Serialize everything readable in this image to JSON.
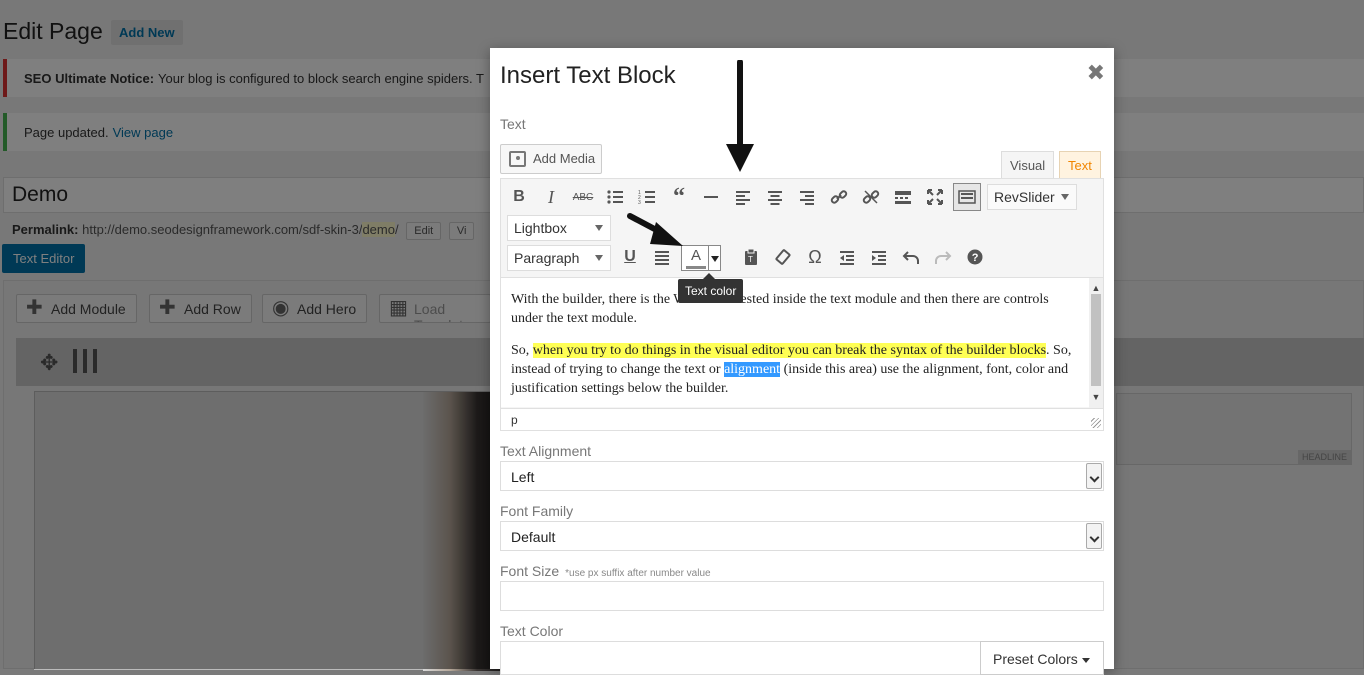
{
  "background": {
    "page_title": "Edit Page",
    "add_new": "Add New",
    "seo_notice": {
      "bold": "SEO Ultimate Notice:",
      "text": "Your blog is configured to block search engine spiders. T"
    },
    "updated_notice": {
      "text": "Page updated.",
      "link": "View page"
    },
    "post_title": "Demo",
    "permalink": {
      "label": "Permalink:",
      "url": "http://demo.seodesignframework.com/sdf-skin-3/",
      "slug": "demo",
      "trailing": "/",
      "edit": "Edit",
      "view": "Vi"
    },
    "text_editor_btn": "Text Editor",
    "builder_buttons": [
      "Add Module",
      "Add Row",
      "Add Hero",
      "Load Templat"
    ],
    "headline_tag": "HEADLINE"
  },
  "modal": {
    "title": "Insert Text Block",
    "text_label": "Text",
    "add_media": "Add Media",
    "tabs": {
      "visual": "Visual",
      "text": "Text"
    },
    "toolbar": {
      "revslider": "RevSlider",
      "lightbox": "Lightbox",
      "paragraph": "Paragraph",
      "tooltip": "Text color"
    },
    "content": {
      "p1": "With the builder, there is the WP editor nested inside the text module and then there are controls under the text module.",
      "p2_pre": "So, ",
      "p2_highlight": "when you try to do things in the visual editor you can break the syntax of the builder blocks",
      "p2_mid": ". So, instead of trying to change the text or ",
      "p2_selected": "alignment",
      "p2_post": " (inside this area) use the alignment, font, color and justification settings below the builder."
    },
    "status_path": "p",
    "fields": {
      "alignment_label": "Text Alignment",
      "alignment_value": "Left",
      "font_family_label": "Font Family",
      "font_family_value": "Default",
      "font_size_label": "Font Size",
      "font_size_hint": "*use px suffix after number value",
      "text_color_label": "Text Color",
      "preset_colors": "Preset Colors"
    }
  },
  "colors": {
    "accent": "#0073aa",
    "highlight": "#ffff55",
    "selection": "#3399ff",
    "tab_text": "#f18500"
  }
}
